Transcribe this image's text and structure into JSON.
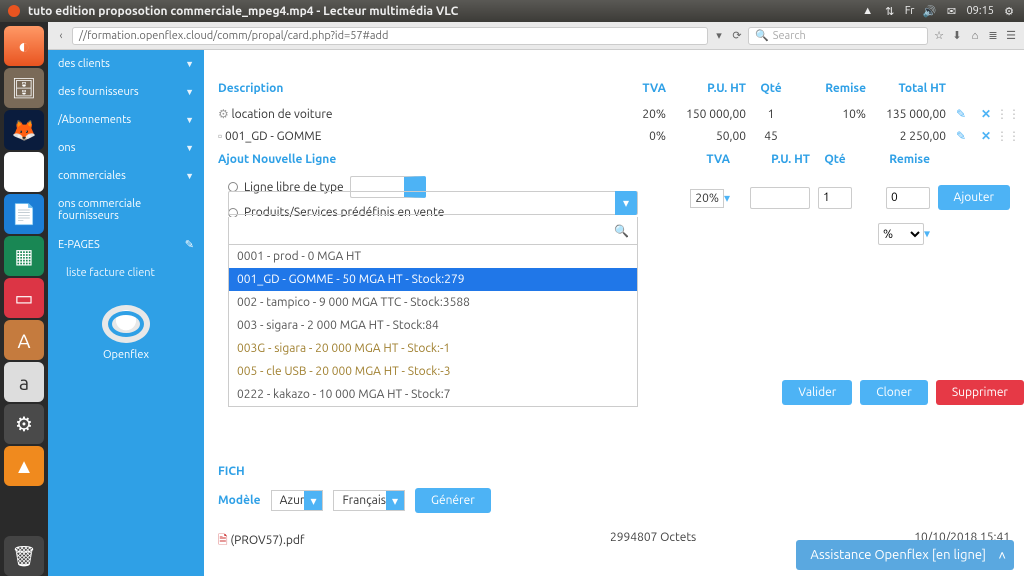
{
  "menubar": {
    "title": "tuto edition proposotion commerciale_mpeg4.mp4 - Lecteur multimédia VLC",
    "lang_ind": "Fr",
    "time": "09:15"
  },
  "browser": {
    "url": "//formation.openflex.cloud/comm/propal/card.php?id=57#add",
    "search_placeholder": "Search"
  },
  "sidebar": {
    "items": [
      "des clients",
      "des fournisseurs",
      "/Abonnements",
      "ons",
      "commerciales",
      "ons commerciale fournisseurs",
      "E-PAGES"
    ],
    "sub": "liste facture client",
    "brand": "Openflex"
  },
  "table": {
    "head": {
      "desc": "Description",
      "tva": "TVA",
      "puht": "P.U. HT",
      "qte": "Qté",
      "remise": "Remise",
      "total": "Total HT"
    },
    "rows": [
      {
        "desc": "location de voiture",
        "tva": "20%",
        "puht": "150 000,00",
        "qte": "1",
        "remise": "10%",
        "total": "135 000,00"
      },
      {
        "desc": "001_GD - GOMME",
        "tva": "0%",
        "puht": "50,00",
        "qte": "45",
        "remise": "",
        "total": "2 250,00"
      }
    ]
  },
  "add": {
    "title": "Ajout Nouvelle Ligne",
    "radio1": "Ligne libre de type",
    "radio2": "Produits/Services prédéfinis en vente",
    "tva_val": "20%",
    "qte_val": "1",
    "remise_val": "0",
    "remise_unit": "%",
    "submit": "Ajouter"
  },
  "combo": {
    "options": [
      "0001 - prod - 0 MGA HT",
      "001_GD - GOMME - 50 MGA HT - Stock:279",
      "002 - tampico - 9 000 MGA TTC - Stock:3588",
      "003 - sigara - 2 000 MGA HT - Stock:84",
      "003G - sigara - 20 000 MGA HT - Stock:-1",
      "005 - cle USB - 20 000 MGA HT - Stock:-3",
      "0222 - kakazo - 10 000 MGA HT - Stock:7"
    ],
    "selected_index": 1
  },
  "actions": {
    "valider": "Valider",
    "cloner": "Cloner",
    "supprimer": "Supprimer"
  },
  "files": {
    "section": "FICH",
    "model_label": "Modèle",
    "model_val": "Azur",
    "lang_val": "Français",
    "gen": "Générer",
    "file_name": "(PROV57).pdf",
    "file_size": "2994807 Octets",
    "file_date": "10/10/2018 15:41"
  },
  "chat": "Assistance Openflex [en ligne]"
}
